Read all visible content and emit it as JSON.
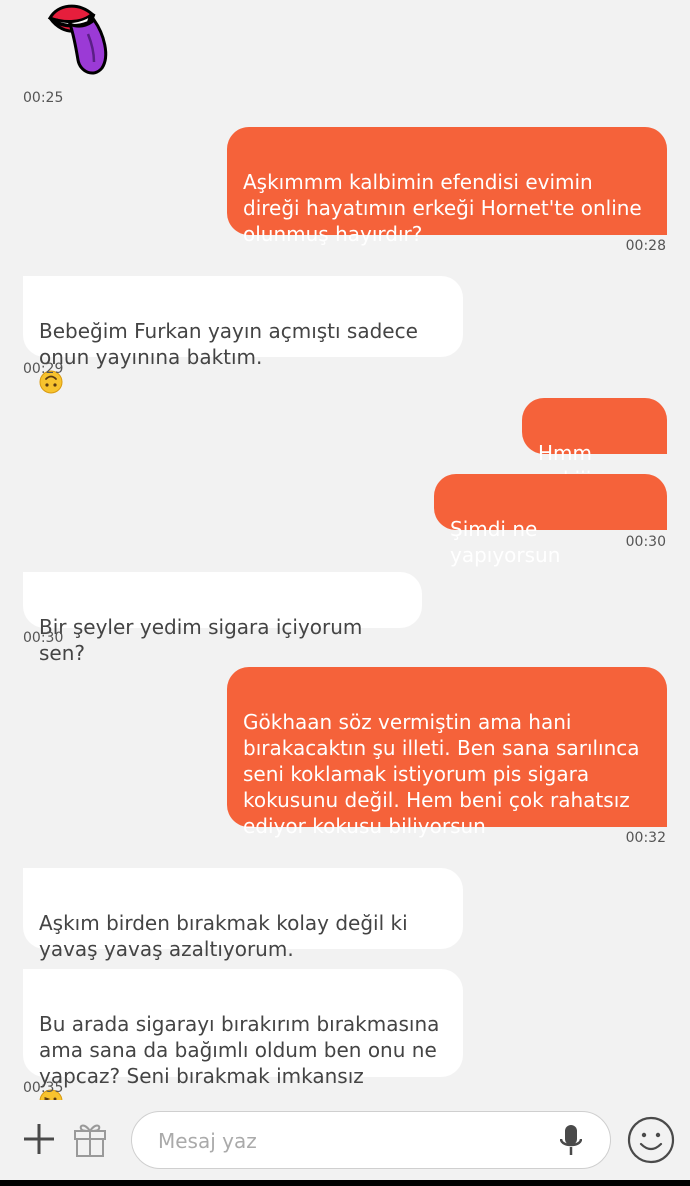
{
  "messages": [
    {
      "id": "m1",
      "text": "Aşkımmm kalbimin efendisi evimin\ndireği hayatımın erkeği Hornet'te online\nolunmuş hayırdır?"
    },
    {
      "id": "m2",
      "text": "Bebeğim Furkan yayın açmıştı sadece\nonun yayınına baktım.",
      "emoji": "upside-down-face"
    },
    {
      "id": "m3",
      "text": "Hmm pekiii"
    },
    {
      "id": "m4",
      "text": "Şimdi ne yapıyorsun"
    },
    {
      "id": "m5",
      "text": "Bir şeyler yedim sigara içiyorum sen?"
    },
    {
      "id": "m6",
      "text": "Gökhaan söz vermiştin ama hani\nbırakacaktın şu illeti. Ben sana sarılınca\nseni koklamak istiyorum pis sigara\nkokusunu değil.  Hem beni çok rahatsız\nediyor kokusu biliyorsun"
    },
    {
      "id": "m7",
      "text": "Aşkım birden bırakmak kolay değil ki\nyavaş yavaş azaltıyorum."
    },
    {
      "id": "m8",
      "text": "Bu arada sigarayı bırakırım bırakmasına\nama sana da bağımlı oldum ben onu ne\nyapcaz? Seni bırakmak imkansız",
      "emoji": "face-blowing-kiss"
    }
  ],
  "times": {
    "t_sticker": "00:25",
    "t_m1": "00:28",
    "t_m2": "00:29",
    "t_m4": "00:30",
    "t_m5": "00:30",
    "t_m6": "00:32",
    "t_m8": "00:35"
  },
  "sticker": {
    "icon": "tongue-lips-sticker"
  },
  "composer": {
    "placeholder": "Mesaj yaz",
    "icons": [
      "plus-icon",
      "gift-icon",
      "microphone-icon",
      "smiley-icon"
    ]
  },
  "colors": {
    "outgoing": "#f5623a",
    "incoming": "#ffffff",
    "background": "#f2f2f2"
  }
}
